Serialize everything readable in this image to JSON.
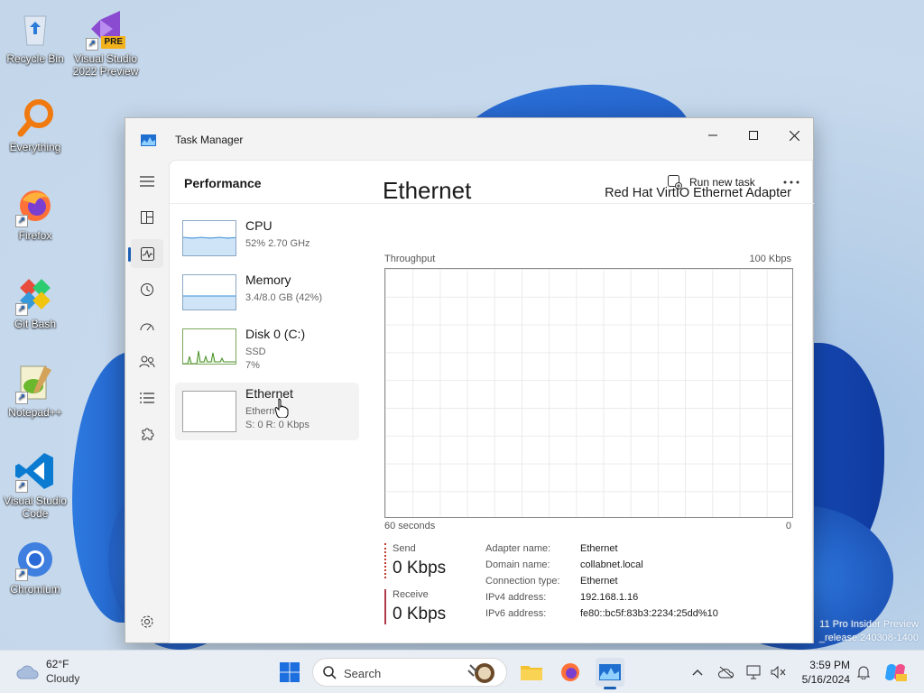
{
  "desktop": {
    "icons": [
      {
        "label": "Recycle Bin",
        "icon": "recycle-bin-icon"
      },
      {
        "label": "Visual Studio 2022 Preview",
        "icon": "visual-studio-icon",
        "badge": "PRE"
      },
      {
        "label": "Everything",
        "icon": "everything-search-icon"
      },
      {
        "label": "Firefox",
        "icon": "firefox-icon"
      },
      {
        "label": "Git Bash",
        "icon": "git-bash-icon"
      },
      {
        "label": "Notepad++",
        "icon": "notepadpp-icon"
      },
      {
        "label": "Visual Studio Code",
        "icon": "vscode-icon"
      },
      {
        "label": "Chromium",
        "icon": "chromium-icon"
      }
    ],
    "watermark": {
      "line1": "11 Pro Insider Preview",
      "line2": "_release.240308-1400"
    }
  },
  "window": {
    "title": "Task Manager",
    "controls": {
      "minimize": "minimize-icon",
      "maximize": "maximize-icon",
      "close": "close-icon"
    }
  },
  "nav": {
    "items": [
      {
        "name": "menu",
        "icon": "hamburger-icon"
      },
      {
        "name": "processes",
        "icon": "processes-icon"
      },
      {
        "name": "performance",
        "icon": "performance-icon",
        "active": true
      },
      {
        "name": "app-history",
        "icon": "history-icon"
      },
      {
        "name": "startup-apps",
        "icon": "speedometer-icon"
      },
      {
        "name": "users",
        "icon": "users-icon"
      },
      {
        "name": "details",
        "icon": "list-icon"
      },
      {
        "name": "services",
        "icon": "puzzle-icon"
      }
    ],
    "settings_icon": "gear-icon"
  },
  "header": {
    "page_title": "Performance",
    "run_new_task": "Run new task",
    "more_icon": "ellipsis-icon"
  },
  "resources": [
    {
      "name": "CPU",
      "line1": "52%  2.70 GHz",
      "line2": "",
      "usage": 0.52
    },
    {
      "name": "Memory",
      "line1": "3.4/8.0 GB (42%)",
      "line2": "",
      "usage": 0.42
    },
    {
      "name": "Disk 0 (C:)",
      "line1": "SSD",
      "line2": "7%",
      "usage": 0.07
    },
    {
      "name": "Ethernet",
      "line1": "Ethern",
      "line2": "S: 0  R: 0 Kbps",
      "usage": 0,
      "selected": true
    }
  ],
  "detail": {
    "title": "Ethernet",
    "adapter": "Red Hat VirtIO Ethernet Adapter",
    "graph_label": "Throughput",
    "graph_max": "100 Kbps",
    "x_left": "60 seconds",
    "x_right": "0",
    "send_label": "Send",
    "send_value": "0 Kbps",
    "receive_label": "Receive",
    "receive_value": "0 Kbps",
    "properties": [
      {
        "key": "Adapter name:",
        "value": "Ethernet"
      },
      {
        "key": "Domain name:",
        "value": "collabnet.local"
      },
      {
        "key": "Connection type:",
        "value": "Ethernet"
      },
      {
        "key": "IPv4 address:",
        "value": "192.168.1.16"
      },
      {
        "key": "IPv6 address:",
        "value": "fe80::bc5f:83b3:2234:25dd%10"
      }
    ]
  },
  "taskbar": {
    "weather": {
      "temp": "62°F",
      "condition": "Cloudy"
    },
    "search_placeholder": "Search",
    "time": "3:59 PM",
    "date": "5/16/2024"
  },
  "colors": {
    "accent": "#1a5fb4",
    "graph_grid": "#ebebeb",
    "send": "#c0382b",
    "receive": "#b03a4a"
  }
}
